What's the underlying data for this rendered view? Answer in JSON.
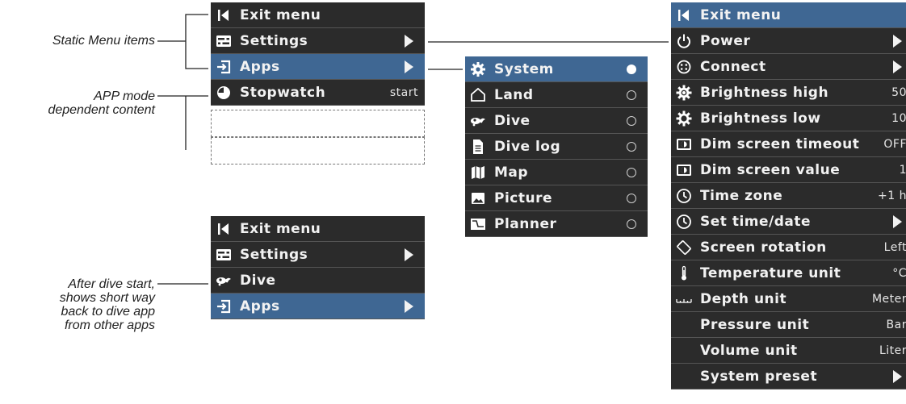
{
  "annotations": {
    "static": "Static Menu items",
    "app_mode_1": "APP mode",
    "app_mode_2": "dependent content",
    "after_1": "After dive start,",
    "after_2": "shows short way",
    "after_3": "back to dive app",
    "after_4": "from other apps"
  },
  "menu_main": [
    {
      "label": "Exit menu",
      "icon": "exit-icon"
    },
    {
      "label": "Settings",
      "icon": "settings-icon",
      "arrow": true
    },
    {
      "label": "Apps",
      "icon": "apps-icon",
      "arrow": true,
      "selected": true
    },
    {
      "label": "Stopwatch",
      "icon": "stopwatch-icon",
      "value": "start"
    }
  ],
  "menu_after": [
    {
      "label": "Exit menu",
      "icon": "exit-icon"
    },
    {
      "label": "Settings",
      "icon": "settings-icon",
      "arrow": true
    },
    {
      "label": "Dive",
      "icon": "dive-icon"
    },
    {
      "label": "Apps",
      "icon": "apps-icon",
      "arrow": true,
      "selected": true
    }
  ],
  "menu_apps": [
    {
      "label": "System",
      "icon": "gear-icon",
      "selected": true,
      "radio": "on"
    },
    {
      "label": "Land",
      "icon": "land-icon",
      "radio": "off"
    },
    {
      "label": "Dive",
      "icon": "dive-icon",
      "radio": "off"
    },
    {
      "label": "Dive log",
      "icon": "divelog-icon",
      "radio": "off"
    },
    {
      "label": "Map",
      "icon": "map-icon",
      "radio": "off"
    },
    {
      "label": "Picture",
      "icon": "picture-icon",
      "radio": "off"
    },
    {
      "label": "Planner",
      "icon": "planner-icon",
      "radio": "off"
    }
  ],
  "menu_settings": [
    {
      "label": "Exit menu",
      "icon": "exit-icon",
      "selected": true
    },
    {
      "label": "Power",
      "icon": "power-icon",
      "arrow": true
    },
    {
      "label": "Connect",
      "icon": "connect-icon",
      "arrow": true
    },
    {
      "label": "Brightness high",
      "icon": "brightness-high-icon",
      "value": "50"
    },
    {
      "label": "Brightness low",
      "icon": "brightness-low-icon",
      "value": "10"
    },
    {
      "label": "Dim screen timeout",
      "icon": "dim-screen-icon",
      "value": "OFF"
    },
    {
      "label": "Dim screen value",
      "icon": "dim-screen-icon",
      "value": "1"
    },
    {
      "label": "Time zone",
      "icon": "clock-icon",
      "value": "+1 h"
    },
    {
      "label": "Set time/date",
      "icon": "clock-icon",
      "arrow": true
    },
    {
      "label": "Screen rotation",
      "icon": "rotation-icon",
      "value": "Left"
    },
    {
      "label": "Temperature unit",
      "icon": "thermometer-icon",
      "value": "°C"
    },
    {
      "label": "Depth unit",
      "icon": "ruler-icon",
      "value": "Meter"
    },
    {
      "label": "Pressure unit",
      "icon": "",
      "value": "Bar"
    },
    {
      "label": "Volume unit",
      "icon": "",
      "value": "Liter"
    },
    {
      "label": "System preset",
      "icon": "",
      "arrow": true
    }
  ],
  "colors": {
    "menu_bg": "#2b2b2b",
    "selected": "#3f6793",
    "text": "#f2f2f2"
  }
}
